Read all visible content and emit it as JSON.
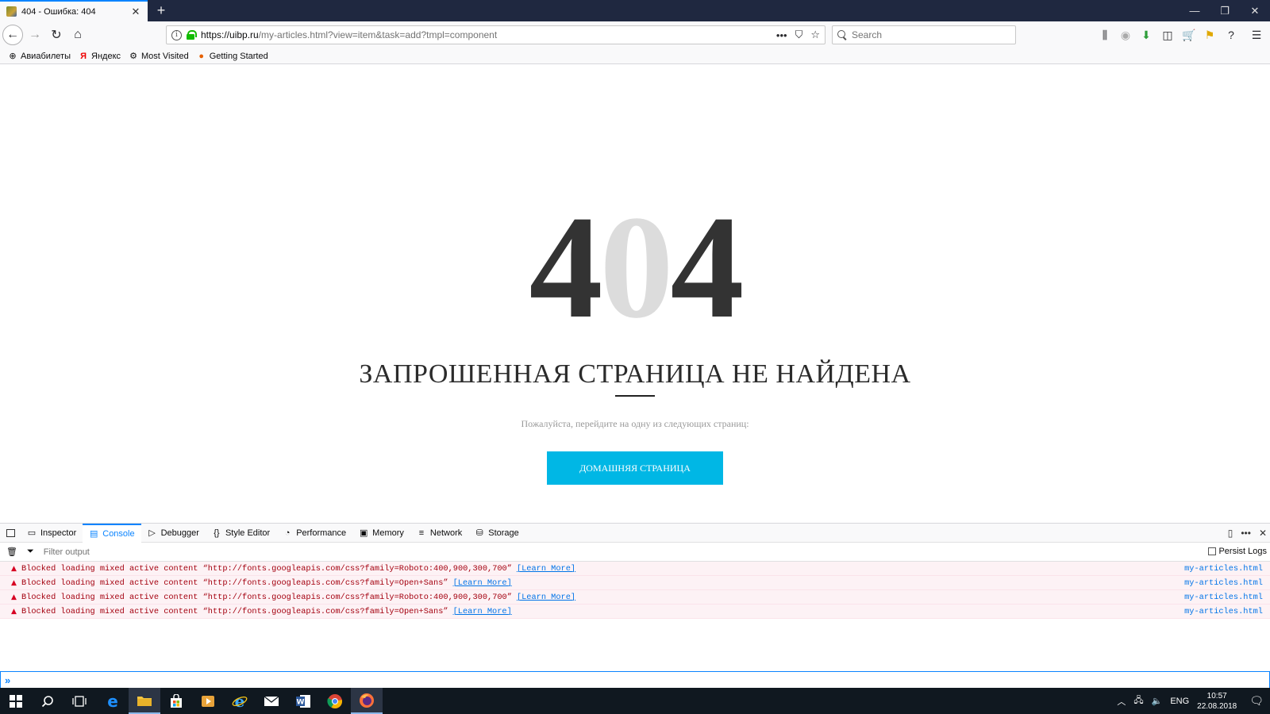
{
  "browser": {
    "tab_title": "404 - Ошибка: 404",
    "url_host": "https://uibp.ru",
    "url_rest": "/my-articles.html?view=item&task=add?tmpl=component",
    "search_placeholder": "Search",
    "bookmarks": [
      "Авиабилеты",
      "Яндекс",
      "Most Visited",
      "Getting Started"
    ]
  },
  "page": {
    "code_left": "4",
    "code_mid": "0",
    "code_right": "4",
    "title": "ЗАПРОШЕННАЯ СТРАНИЦА НЕ НАЙДЕНА",
    "subtitle": "Пожалуйста, перейдите на одну из следующих страниц:",
    "home_button": "ДОМАШНЯЯ СТРАНИЦА",
    "accent": "#00b7e5"
  },
  "devtools": {
    "tabs": [
      "Inspector",
      "Console",
      "Debugger",
      "Style Editor",
      "Performance",
      "Memory",
      "Network",
      "Storage"
    ],
    "active_tab": "Console",
    "filter_placeholder": "Filter output",
    "persist_logs": "Persist Logs",
    "messages": [
      {
        "text": "Blocked loading mixed active content “http://fonts.googleapis.com/css?family=Roboto:400,900,300,700”",
        "link": "[Learn More]",
        "source": "my-articles.html"
      },
      {
        "text": "Blocked loading mixed active content “http://fonts.googleapis.com/css?family=Open+Sans”",
        "link": "[Learn More]",
        "source": "my-articles.html"
      },
      {
        "text": "Blocked loading mixed active content “http://fonts.googleapis.com/css?family=Roboto:400,900,300,700”",
        "link": "[Learn More]",
        "source": "my-articles.html"
      },
      {
        "text": "Blocked loading mixed active content “http://fonts.googleapis.com/css?family=Open+Sans”",
        "link": "[Learn More]",
        "source": "my-articles.html"
      }
    ]
  },
  "taskbar": {
    "lang": "ENG",
    "time": "10:57",
    "date": "22.08.2018"
  }
}
